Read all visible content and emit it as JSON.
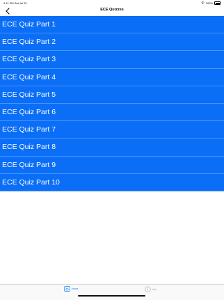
{
  "status_bar": {
    "time": "9:11 PM",
    "date": "Sat Jul 22",
    "battery": "100%"
  },
  "nav": {
    "title": "ECE Quizzes"
  },
  "list": {
    "items": [
      {
        "label": "ECE Quiz Part 1"
      },
      {
        "label": "ECE Quiz Part 2"
      },
      {
        "label": "ECE Quiz Part 3"
      },
      {
        "label": "ECE Quiz Part 4"
      },
      {
        "label": "ECE Quiz Part 5"
      },
      {
        "label": "ECE Quiz Part 6"
      },
      {
        "label": "ECE Quiz Part 7"
      },
      {
        "label": "ECE Quiz Part 8"
      },
      {
        "label": "ECE Quiz Part 9"
      },
      {
        "label": "ECE Quiz Part 10"
      }
    ]
  },
  "tab_bar": {
    "home_label": "Home",
    "info_label": "Info"
  },
  "colors": {
    "list_background": "#0a6ef7",
    "list_text": "#ffffff",
    "tab_active": "#1a7ff7",
    "tab_inactive": "#a0a0a0"
  },
  "icons": {
    "back": "chevron-left-icon",
    "home": "home-icon",
    "info": "info-icon",
    "wifi": "wifi-icon",
    "battery": "battery-icon"
  }
}
